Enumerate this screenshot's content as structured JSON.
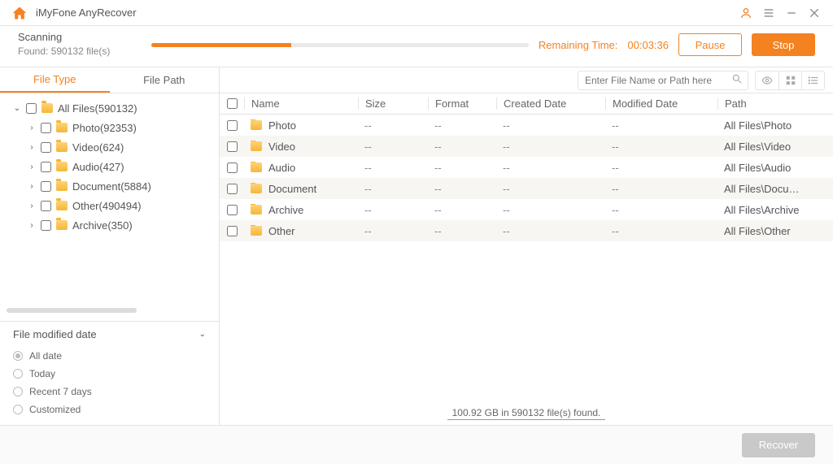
{
  "app": {
    "title": "iMyFone AnyRecover"
  },
  "status": {
    "title": "Scanning",
    "found": "Found: 590132 file(s)",
    "remaining_label": "Remaining Time:",
    "remaining_time": "00:03:36",
    "progress_pct": 37
  },
  "buttons": {
    "pause": "Pause",
    "stop": "Stop",
    "recover": "Recover"
  },
  "tabs": {
    "file_type": "File Type",
    "file_path": "File Path"
  },
  "tree": [
    {
      "label": "All Files(590132)",
      "depth": 0,
      "expanded": true
    },
    {
      "label": "Photo(92353)",
      "depth": 1,
      "expanded": false
    },
    {
      "label": "Video(624)",
      "depth": 1,
      "expanded": false
    },
    {
      "label": "Audio(427)",
      "depth": 1,
      "expanded": false
    },
    {
      "label": "Document(5884)",
      "depth": 1,
      "expanded": false
    },
    {
      "label": "Other(490494)",
      "depth": 1,
      "expanded": false
    },
    {
      "label": "Archive(350)",
      "depth": 1,
      "expanded": false
    }
  ],
  "filter": {
    "title": "File modified date",
    "options": [
      "All date",
      "Today",
      "Recent 7 days",
      "Customized"
    ],
    "selected": 0
  },
  "search": {
    "placeholder": "Enter File Name or Path here"
  },
  "columns": {
    "name": "Name",
    "size": "Size",
    "format": "Format",
    "cdate": "Created Date",
    "mdate": "Modified Date",
    "path": "Path"
  },
  "rows": [
    {
      "name": "Photo",
      "size": "--",
      "format": "--",
      "cdate": "--",
      "mdate": "--",
      "path": "All Files\\Photo"
    },
    {
      "name": "Video",
      "size": "--",
      "format": "--",
      "cdate": "--",
      "mdate": "--",
      "path": "All Files\\Video"
    },
    {
      "name": "Audio",
      "size": "--",
      "format": "--",
      "cdate": "--",
      "mdate": "--",
      "path": "All Files\\Audio"
    },
    {
      "name": "Document",
      "size": "--",
      "format": "--",
      "cdate": "--",
      "mdate": "--",
      "path": "All Files\\Docu…"
    },
    {
      "name": "Archive",
      "size": "--",
      "format": "--",
      "cdate": "--",
      "mdate": "--",
      "path": "All Files\\Archive"
    },
    {
      "name": "Other",
      "size": "--",
      "format": "--",
      "cdate": "--",
      "mdate": "--",
      "path": "All Files\\Other"
    }
  ],
  "summary": "100.92 GB in 590132 file(s) found."
}
